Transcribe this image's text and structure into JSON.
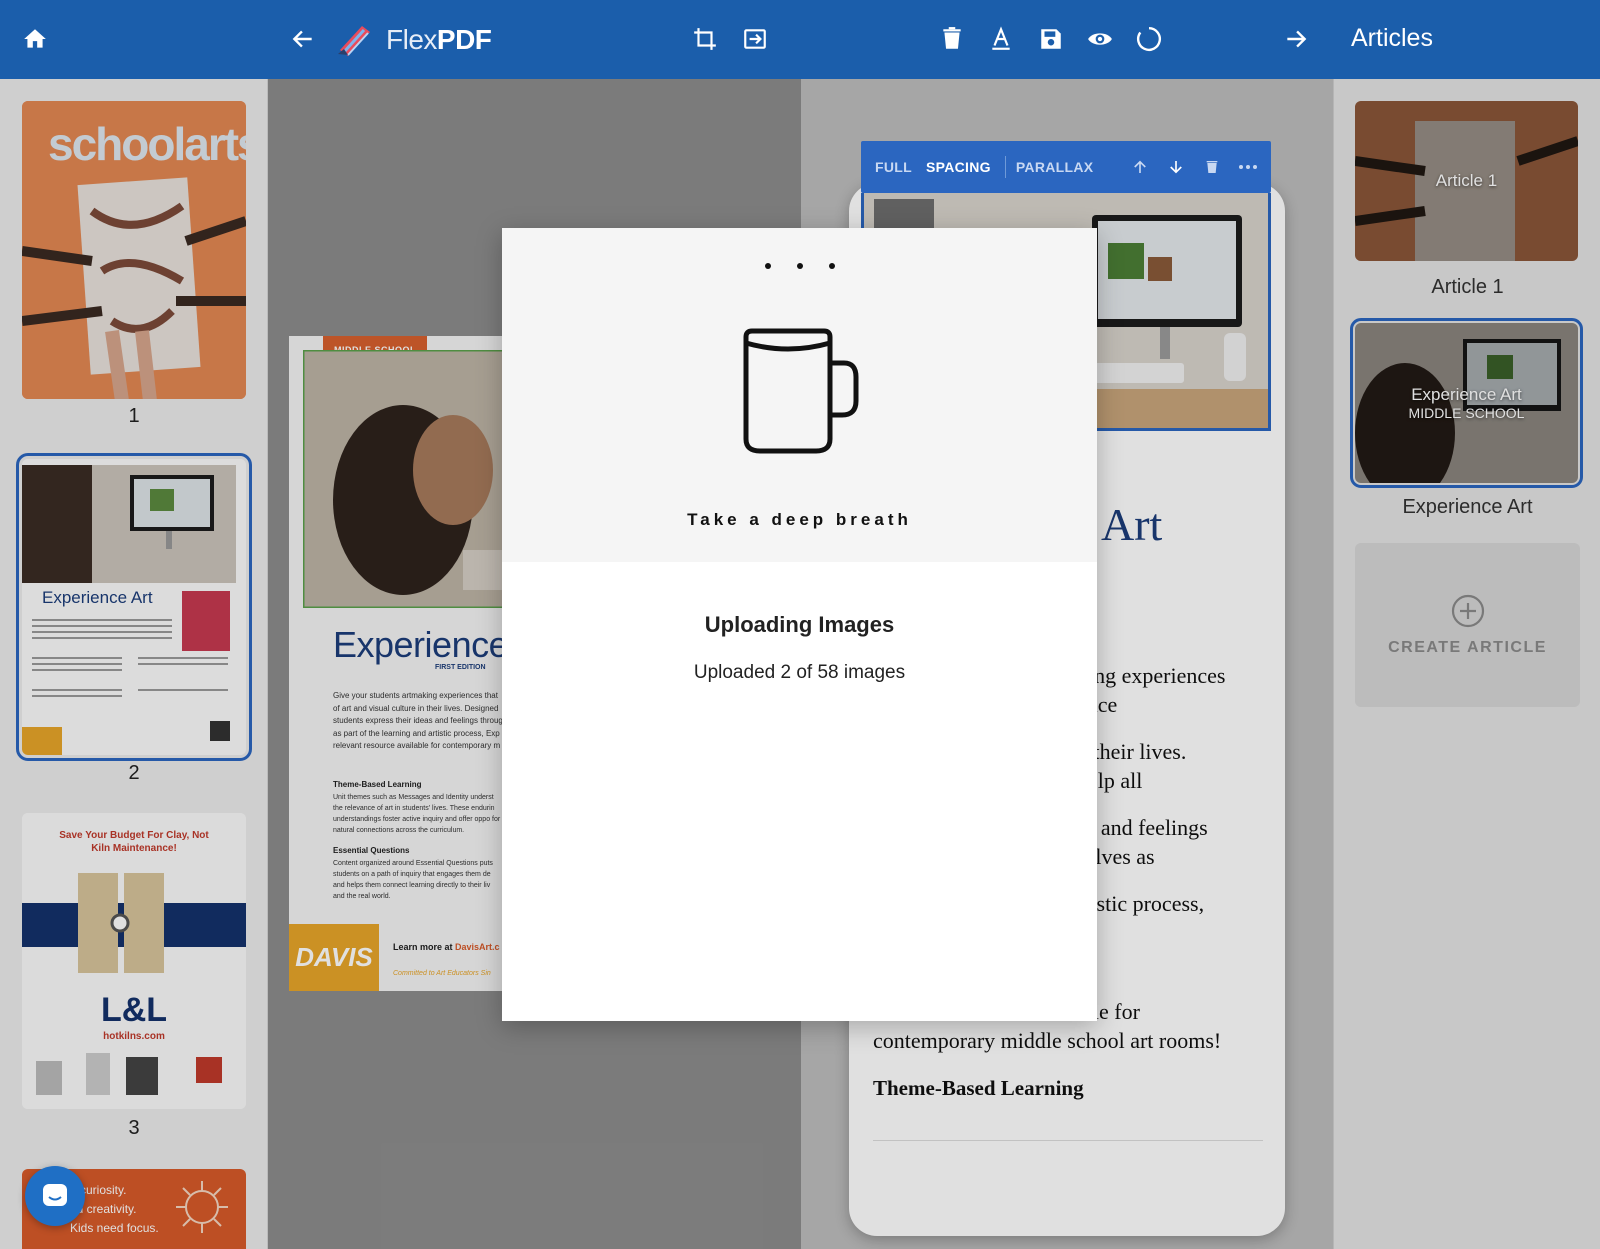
{
  "app": {
    "name_light": "Flex",
    "name_bold": "PDF"
  },
  "toolbar": {
    "home_icon": "home-icon",
    "back_icon": "arrow-left-icon",
    "crop_icon": "crop-icon",
    "import_icon": "import-icon",
    "delete_icon": "trash-icon",
    "text_icon": "text-format-icon",
    "save_icon": "save-icon",
    "preview_icon": "eye-icon",
    "sync_icon": "loading-icon",
    "forward_icon": "arrow-right-icon",
    "panel_title": "Articles"
  },
  "left_sidebar": {
    "pages": [
      {
        "number": "1",
        "cover_title": "schoolarts"
      },
      {
        "number": "2",
        "title": "Experience Art",
        "selected": true
      },
      {
        "number": "3",
        "headline": "Save Your Budget For Clay, Not Kiln Maintenance!",
        "brand": "L&L",
        "site": "hotkilns.com"
      },
      {
        "number": "",
        "lines": [
          "d curiosity.",
          "ed creativity.",
          "Kids need focus."
        ]
      }
    ]
  },
  "center": {
    "badge": "MIDDLE SCHOOL",
    "title": "Experience",
    "edition": "FIRST EDITION",
    "body": "Give your students artmaking experiences that of art and visual culture in their lives. Designed students express their ideas and feelings throug as part of the learning and artistic process, Exp relevant resource available for contemporary m",
    "section1": "Theme-Based Learning",
    "section1_body": "Unit themes such as Messages and Identity underst the relevance of art in students' lives. These endurin understandings foster active inquiry and offer oppo for natural connections across the curriculum.",
    "section2": "Essential Questions",
    "section2_body": "Content organized around Essential Questions puts students on a path of inquiry that engages them de and helps them connect learning directly to their liv and the real world.",
    "footer_logo": "DAVIS",
    "footer_text": "Learn more at ",
    "footer_link": "DavisArt.c",
    "footer_tagline": "Committed to Art Educators Sin"
  },
  "editor": {
    "block_modes": [
      "FULL",
      "SPACING",
      "PARALLAX"
    ],
    "active_mode": "SPACING",
    "block_icons": [
      "arrow-up-icon",
      "arrow-down-icon",
      "trash-icon",
      "more-icon"
    ],
    "heading_fragment": "Art",
    "paragraph_fragments": [
      "king experiences",
      "ance",
      "n their lives.",
      "help all",
      "as and feelings",
      "selves as",
      "rtistic process,"
    ],
    "paragraph_tail_1": "relevant resource available for",
    "paragraph_tail_2": "contemporary middle school art rooms!",
    "subheading": "Theme-Based Learning"
  },
  "articles": {
    "items": [
      {
        "overlay": "Article 1",
        "overlay_sub": "",
        "label": "Article 1",
        "selected": false
      },
      {
        "overlay": "Experience Art",
        "overlay_sub": "MIDDLE SCHOOL",
        "label": "Experience Art",
        "selected": true
      }
    ],
    "create_label": "CREATE ARTICLE",
    "create_icon": "plus-circle-icon"
  },
  "modal": {
    "icon": "mug-icon",
    "tagline": "Take a deep breath",
    "title": "Uploading Images",
    "status": "Uploaded 2 of 58 images",
    "uploaded": 2,
    "total": 58
  },
  "chat": {
    "icon": "chat-icon"
  },
  "colors": {
    "primary": "#1b5eab",
    "accent": "#2b66c0",
    "davis_orange": "#e8a529",
    "kiln_red": "#c0392b"
  }
}
